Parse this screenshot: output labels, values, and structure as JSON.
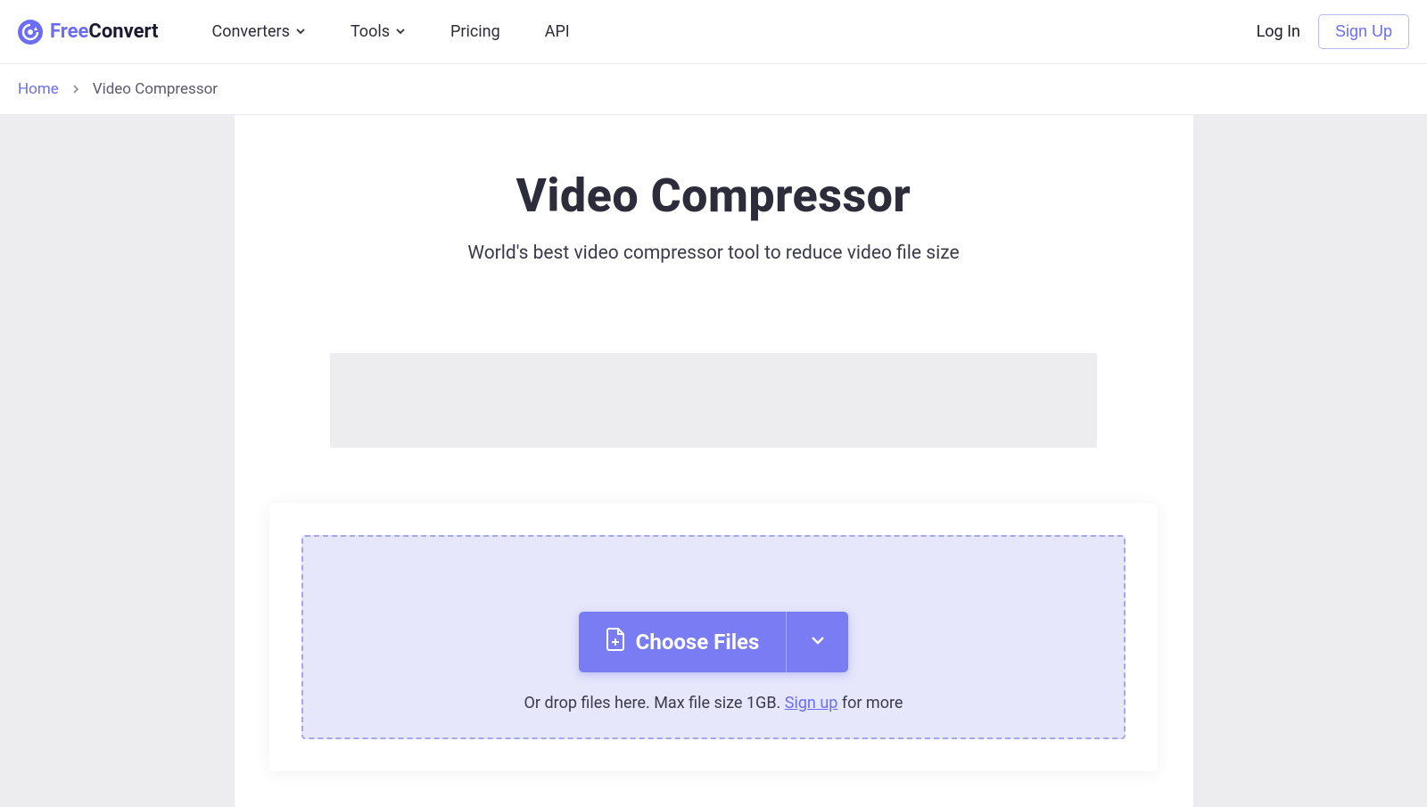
{
  "header": {
    "logo_free": "Free",
    "logo_convert": "Convert",
    "nav": {
      "converters": "Converters",
      "tools": "Tools",
      "pricing": "Pricing",
      "api": "API"
    },
    "login": "Log In",
    "signup": "Sign Up"
  },
  "breadcrumb": {
    "home": "Home",
    "current": "Video Compressor"
  },
  "main": {
    "title": "Video Compressor",
    "subtitle": "World's best video compressor tool to reduce video file size",
    "choose_files": "Choose Files",
    "drop_prefix": "Or drop files here. Max file size 1GB. ",
    "signup_link": "Sign up",
    "drop_suffix": " for more"
  }
}
